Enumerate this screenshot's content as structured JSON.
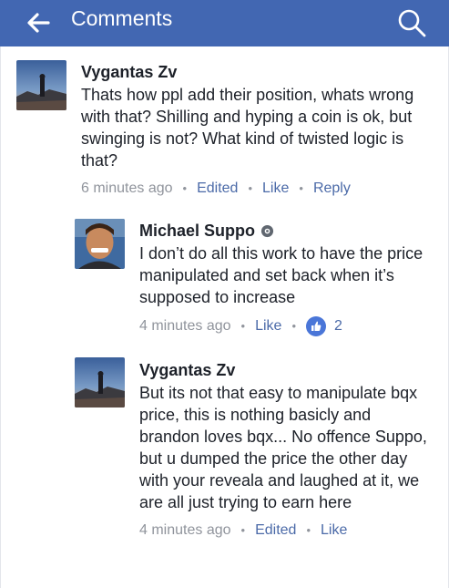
{
  "header": {
    "title": "Comments",
    "back_icon": "arrow-left-icon",
    "search_icon": "search-icon",
    "background": "#4267b2"
  },
  "comments": [
    {
      "author": "Vygantas Zv",
      "text": "Thats how ppl add their position, whats wrong with that? Shilling and hyping a coin is ok, but swinging is not? What kind of twisted logic is that?",
      "time": "6 minutes ago",
      "edited": "Edited",
      "like": "Like",
      "reply": "Reply"
    },
    {
      "author": "Michael Suppo",
      "badge_icon": "gear-badge-icon",
      "text": "I don’t do all this work to have the price manipulated and set back when it’s supposed to increase",
      "time": "4 minutes ago",
      "like": "Like",
      "like_count": "2"
    },
    {
      "author": "Vygantas Zv",
      "text": "But its not that easy to manipulate bqx price, this is nothing basicly and brandon loves bqx... No offence Suppo, but u dumped the price the other day with your reveala and laughed at it, we are all just trying to earn here",
      "time": "4 minutes ago",
      "edited": "Edited",
      "like": "Like"
    }
  ]
}
